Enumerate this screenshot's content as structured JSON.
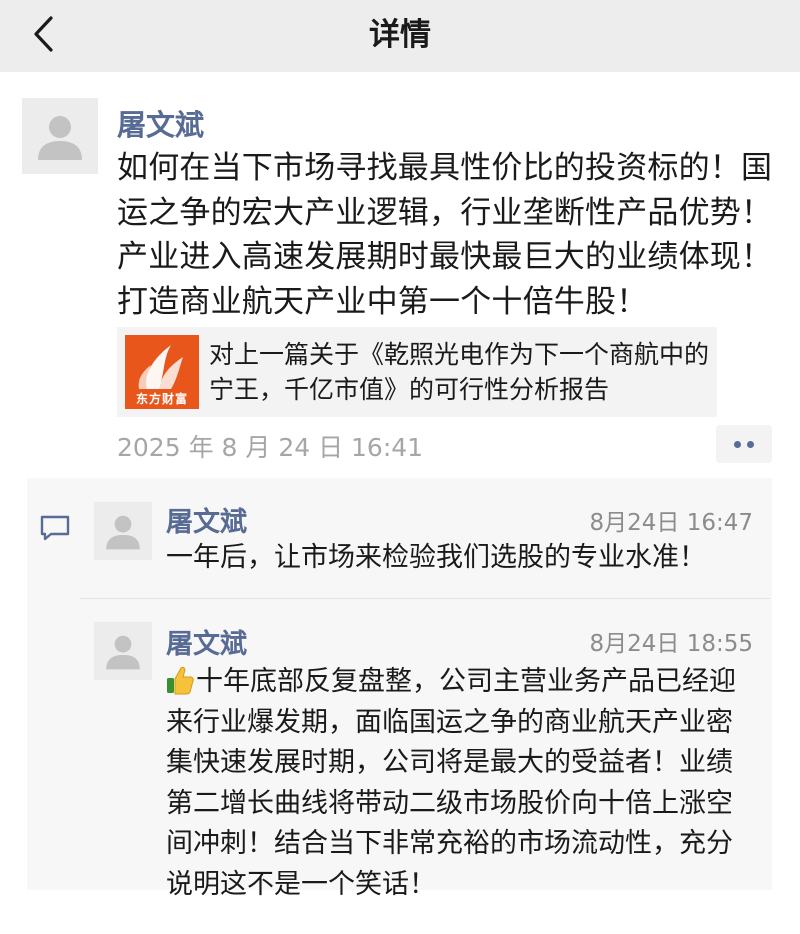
{
  "navbar": {
    "title": "详情",
    "back_icon": "chevron-left-icon"
  },
  "post": {
    "author": "屠文斌",
    "text": "如何在当下市场寻找最具性价比的投资标的！国运之争的宏大产业逻辑，行业垄断性产品优势！产业进入高速发展期时最快最巨大的业绩体现！打造商业航天产业中第一个十倍牛股！",
    "share": {
      "logo_text": "东方财富",
      "title": "对上一篇关于《乾照光电作为下一个商航中的宁王，千亿市值》的可行性分析报告"
    },
    "time": "2025 年 8 月 24 日 16:41",
    "more_icon": "more-dots-icon"
  },
  "comments": [
    {
      "author": "屠文斌",
      "time": "8月24日 16:47",
      "text": "一年后，让市场来检验我们选股的专业水准！"
    },
    {
      "author": "屠文斌",
      "time": "8月24日 18:55",
      "emoji": "thumbs-up",
      "text": "十年底部反复盘整，公司主营业务产品已经迎来行业爆发期，面临国运之争的商业航天产业密集快速发展时期，公司将是最大的受益者！业绩第二增长曲线将带动二级市场股价向十倍上涨空间冲刺！结合当下非常充裕的市场流动性，充分说明这不是一个笑话！"
    }
  ],
  "colors": {
    "nav_bg": "#ededed",
    "link_name": "#576b95",
    "time_gray": "#a6a6a6",
    "comment_bg": "#f7f7f7",
    "logo_orange": "#e8561c"
  }
}
